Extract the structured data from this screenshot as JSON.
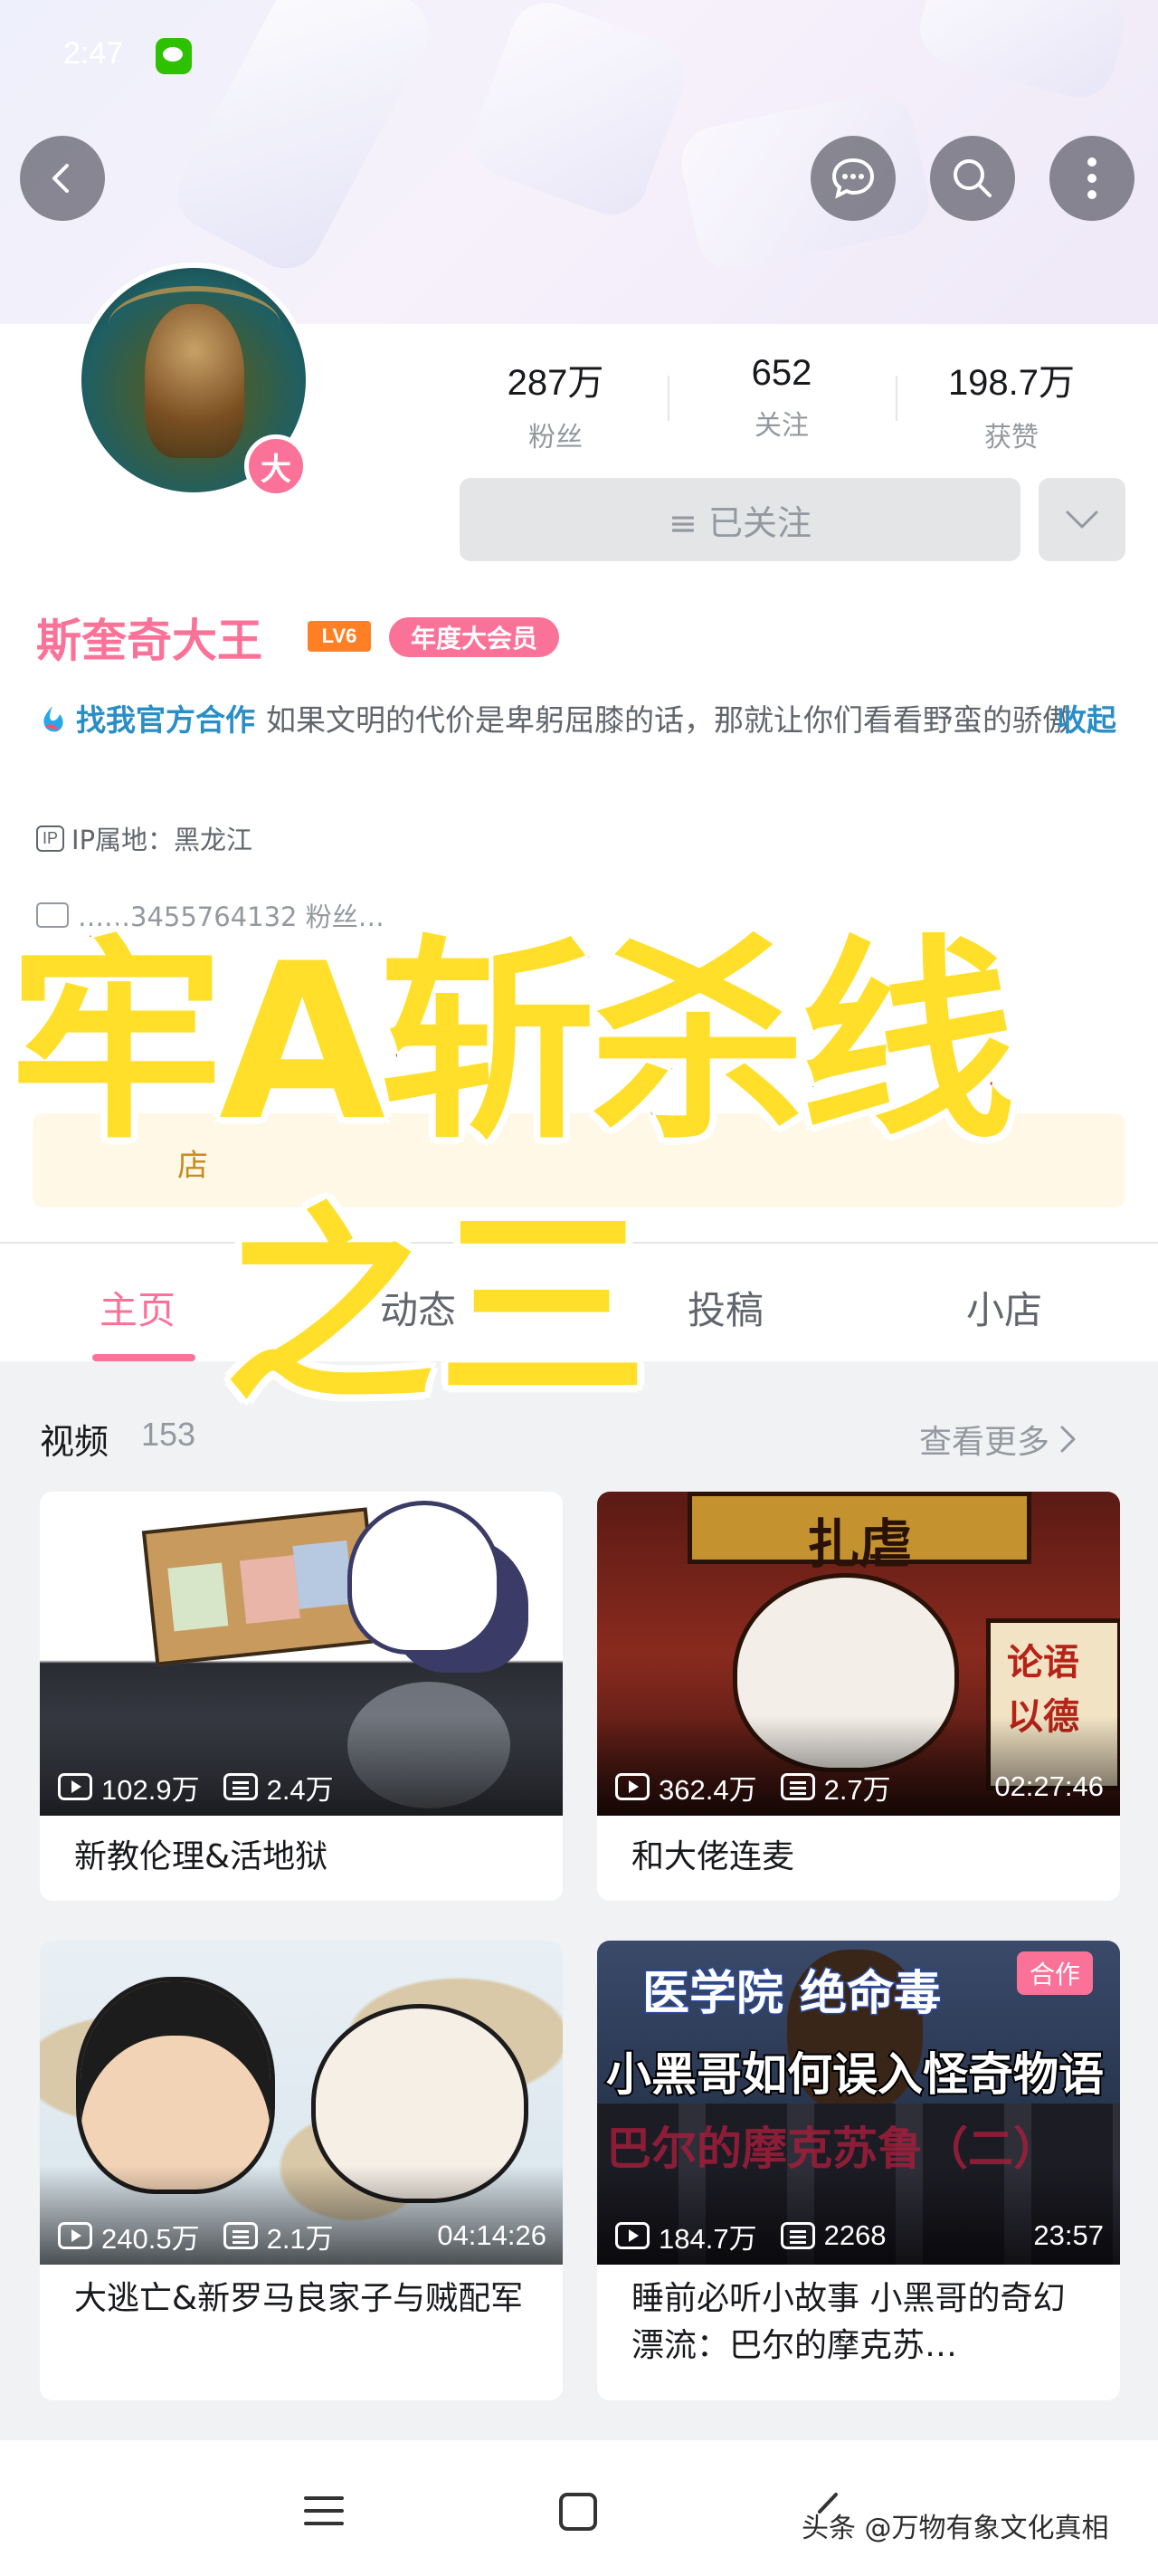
{
  "status_bar": {
    "time": "2:47",
    "right": ""
  },
  "stats": [
    {
      "value": "287万",
      "label": "粉丝"
    },
    {
      "value": "652",
      "label": "关注"
    },
    {
      "value": "198.7万",
      "label": "获赞"
    }
  ],
  "profile": {
    "badge": "大",
    "follow_label": "≡ 已关注",
    "name": "斯奎奇大王",
    "level": "LV6",
    "vip_label": "年度大会员",
    "org_label": "找我官方合作",
    "bio": "如果文明的代价是卑躬屈膝的话，那就让你们看看野蛮的骄傲",
    "collapse_label": "收起",
    "ip_badge": "IP",
    "ip_location": "IP属地：黑龙江",
    "uid": "……3455764132 粉丝…",
    "shop_text": "店"
  },
  "tabs": [
    {
      "label": "主页",
      "active": true
    },
    {
      "label": "动态",
      "active": false
    },
    {
      "label": "投稿",
      "active": false
    },
    {
      "label": "小店",
      "active": false
    }
  ],
  "overlay": {
    "line1": "牢A斩杀线",
    "line2": "之三"
  },
  "videos_section": {
    "title": "视频",
    "count": "153",
    "see_more": "查看更多"
  },
  "videos": [
    {
      "views": "102.9万",
      "danmaku": "2.4万",
      "duration": "",
      "title": "新教伦理&活地狱",
      "tag": ""
    },
    {
      "views": "362.4万",
      "danmaku": "2.7万",
      "duration": "02:27:46",
      "title": "和大佬连麦",
      "tag": ""
    },
    {
      "views": "240.5万",
      "danmaku": "2.1万",
      "duration": "04:14:26",
      "title": "大逃亡&新罗马良家子与贼配军",
      "tag": ""
    },
    {
      "views": "184.7万",
      "danmaku": "2268",
      "duration": "23:57",
      "title": "睡前必听小故事 小黑哥的奇幻漂流：巴尔的摩克苏…",
      "tag": "合作"
    }
  ],
  "thumb_text": {
    "v4_top": "医学院 绝命毒",
    "v4_mid": "小黑哥如何误入怪奇物语",
    "v4_bottom": "巴尔的摩克苏鲁（二）"
  },
  "watermark": "头条 @万物有象文化真相",
  "colors": {
    "accent": "#fb7299",
    "link": "#2a8ec6",
    "overlay_fill": "#ffdf2a",
    "overlay_stroke": "#d81e06"
  }
}
